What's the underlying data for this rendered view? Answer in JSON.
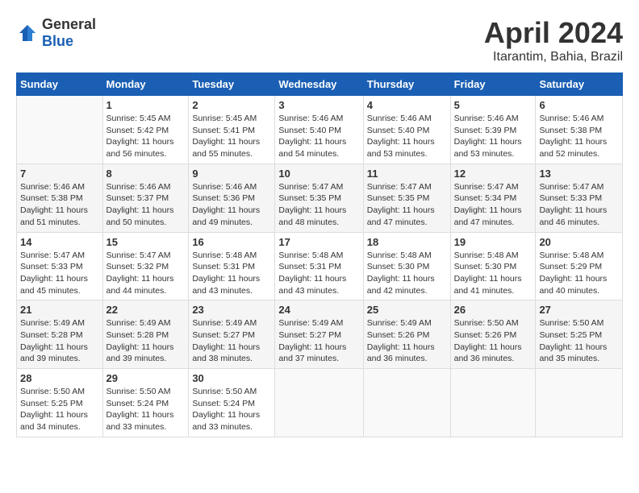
{
  "header": {
    "logo_general": "General",
    "logo_blue": "Blue",
    "month_year": "April 2024",
    "location": "Itarantim, Bahia, Brazil"
  },
  "days_of_week": [
    "Sunday",
    "Monday",
    "Tuesday",
    "Wednesday",
    "Thursday",
    "Friday",
    "Saturday"
  ],
  "weeks": [
    [
      {
        "day": "",
        "info": ""
      },
      {
        "day": "1",
        "info": "Sunrise: 5:45 AM\nSunset: 5:42 PM\nDaylight: 11 hours\nand 56 minutes."
      },
      {
        "day": "2",
        "info": "Sunrise: 5:45 AM\nSunset: 5:41 PM\nDaylight: 11 hours\nand 55 minutes."
      },
      {
        "day": "3",
        "info": "Sunrise: 5:46 AM\nSunset: 5:40 PM\nDaylight: 11 hours\nand 54 minutes."
      },
      {
        "day": "4",
        "info": "Sunrise: 5:46 AM\nSunset: 5:40 PM\nDaylight: 11 hours\nand 53 minutes."
      },
      {
        "day": "5",
        "info": "Sunrise: 5:46 AM\nSunset: 5:39 PM\nDaylight: 11 hours\nand 53 minutes."
      },
      {
        "day": "6",
        "info": "Sunrise: 5:46 AM\nSunset: 5:38 PM\nDaylight: 11 hours\nand 52 minutes."
      }
    ],
    [
      {
        "day": "7",
        "info": "Sunrise: 5:46 AM\nSunset: 5:38 PM\nDaylight: 11 hours\nand 51 minutes."
      },
      {
        "day": "8",
        "info": "Sunrise: 5:46 AM\nSunset: 5:37 PM\nDaylight: 11 hours\nand 50 minutes."
      },
      {
        "day": "9",
        "info": "Sunrise: 5:46 AM\nSunset: 5:36 PM\nDaylight: 11 hours\nand 49 minutes."
      },
      {
        "day": "10",
        "info": "Sunrise: 5:47 AM\nSunset: 5:35 PM\nDaylight: 11 hours\nand 48 minutes."
      },
      {
        "day": "11",
        "info": "Sunrise: 5:47 AM\nSunset: 5:35 PM\nDaylight: 11 hours\nand 47 minutes."
      },
      {
        "day": "12",
        "info": "Sunrise: 5:47 AM\nSunset: 5:34 PM\nDaylight: 11 hours\nand 47 minutes."
      },
      {
        "day": "13",
        "info": "Sunrise: 5:47 AM\nSunset: 5:33 PM\nDaylight: 11 hours\nand 46 minutes."
      }
    ],
    [
      {
        "day": "14",
        "info": "Sunrise: 5:47 AM\nSunset: 5:33 PM\nDaylight: 11 hours\nand 45 minutes."
      },
      {
        "day": "15",
        "info": "Sunrise: 5:47 AM\nSunset: 5:32 PM\nDaylight: 11 hours\nand 44 minutes."
      },
      {
        "day": "16",
        "info": "Sunrise: 5:48 AM\nSunset: 5:31 PM\nDaylight: 11 hours\nand 43 minutes."
      },
      {
        "day": "17",
        "info": "Sunrise: 5:48 AM\nSunset: 5:31 PM\nDaylight: 11 hours\nand 43 minutes."
      },
      {
        "day": "18",
        "info": "Sunrise: 5:48 AM\nSunset: 5:30 PM\nDaylight: 11 hours\nand 42 minutes."
      },
      {
        "day": "19",
        "info": "Sunrise: 5:48 AM\nSunset: 5:30 PM\nDaylight: 11 hours\nand 41 minutes."
      },
      {
        "day": "20",
        "info": "Sunrise: 5:48 AM\nSunset: 5:29 PM\nDaylight: 11 hours\nand 40 minutes."
      }
    ],
    [
      {
        "day": "21",
        "info": "Sunrise: 5:49 AM\nSunset: 5:28 PM\nDaylight: 11 hours\nand 39 minutes."
      },
      {
        "day": "22",
        "info": "Sunrise: 5:49 AM\nSunset: 5:28 PM\nDaylight: 11 hours\nand 39 minutes."
      },
      {
        "day": "23",
        "info": "Sunrise: 5:49 AM\nSunset: 5:27 PM\nDaylight: 11 hours\nand 38 minutes."
      },
      {
        "day": "24",
        "info": "Sunrise: 5:49 AM\nSunset: 5:27 PM\nDaylight: 11 hours\nand 37 minutes."
      },
      {
        "day": "25",
        "info": "Sunrise: 5:49 AM\nSunset: 5:26 PM\nDaylight: 11 hours\nand 36 minutes."
      },
      {
        "day": "26",
        "info": "Sunrise: 5:50 AM\nSunset: 5:26 PM\nDaylight: 11 hours\nand 36 minutes."
      },
      {
        "day": "27",
        "info": "Sunrise: 5:50 AM\nSunset: 5:25 PM\nDaylight: 11 hours\nand 35 minutes."
      }
    ],
    [
      {
        "day": "28",
        "info": "Sunrise: 5:50 AM\nSunset: 5:25 PM\nDaylight: 11 hours\nand 34 minutes."
      },
      {
        "day": "29",
        "info": "Sunrise: 5:50 AM\nSunset: 5:24 PM\nDaylight: 11 hours\nand 33 minutes."
      },
      {
        "day": "30",
        "info": "Sunrise: 5:50 AM\nSunset: 5:24 PM\nDaylight: 11 hours\nand 33 minutes."
      },
      {
        "day": "",
        "info": ""
      },
      {
        "day": "",
        "info": ""
      },
      {
        "day": "",
        "info": ""
      },
      {
        "day": "",
        "info": ""
      }
    ]
  ]
}
